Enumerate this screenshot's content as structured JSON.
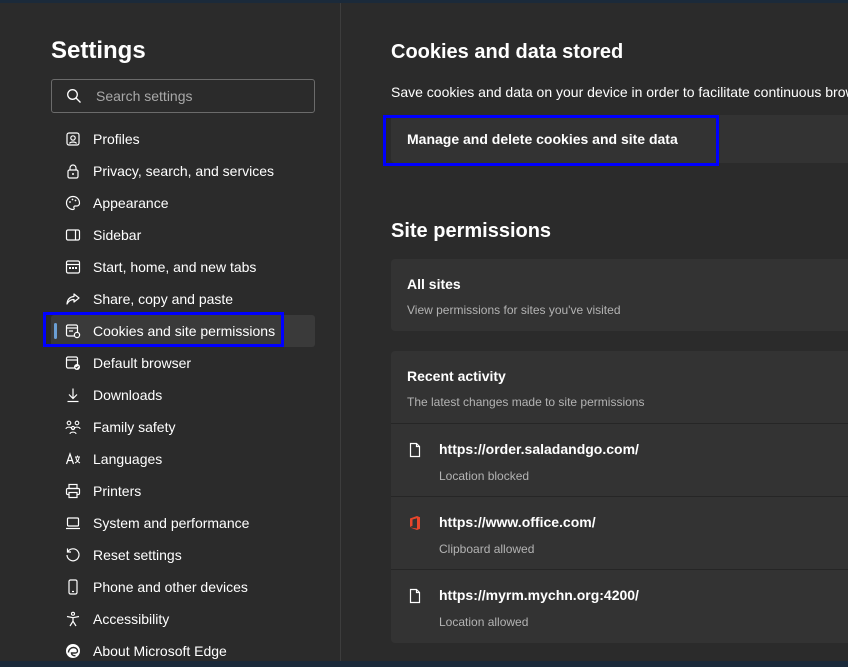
{
  "sidebar": {
    "title": "Settings",
    "search_placeholder": "Search settings",
    "items": [
      {
        "label": "Profiles"
      },
      {
        "label": "Privacy, search, and services"
      },
      {
        "label": "Appearance"
      },
      {
        "label": "Sidebar"
      },
      {
        "label": "Start, home, and new tabs"
      },
      {
        "label": "Share, copy and paste"
      },
      {
        "label": "Cookies and site permissions",
        "selected": true
      },
      {
        "label": "Default browser"
      },
      {
        "label": "Downloads"
      },
      {
        "label": "Family safety"
      },
      {
        "label": "Languages"
      },
      {
        "label": "Printers"
      },
      {
        "label": "System and performance"
      },
      {
        "label": "Reset settings"
      },
      {
        "label": "Phone and other devices"
      },
      {
        "label": "Accessibility"
      },
      {
        "label": "About Microsoft Edge"
      }
    ]
  },
  "main": {
    "cookies_section": {
      "title": "Cookies and data stored",
      "description": "Save cookies and data on your device in order to facilitate continuous brow",
      "manage_label": "Manage and delete cookies and site data"
    },
    "permissions_section": {
      "title": "Site permissions",
      "all_sites": {
        "title": "All sites",
        "subtitle": "View permissions for sites you've visited"
      },
      "recent_activity": {
        "title": "Recent activity",
        "subtitle": "The latest changes made to site permissions",
        "entries": [
          {
            "url": "https://order.saladandgo.com/",
            "status": "Location blocked",
            "icon": "page-icon"
          },
          {
            "url": "https://www.office.com/",
            "status": "Clipboard allowed",
            "icon": "office-icon"
          },
          {
            "url": "https://myrm.mychn.org:4200/",
            "status": "Location allowed",
            "icon": "page-icon"
          }
        ]
      }
    }
  },
  "colors": {
    "background": "#2b2b2b",
    "card": "#333333",
    "accent": "#6b9fd4",
    "annotation_box": "#0000ff"
  }
}
